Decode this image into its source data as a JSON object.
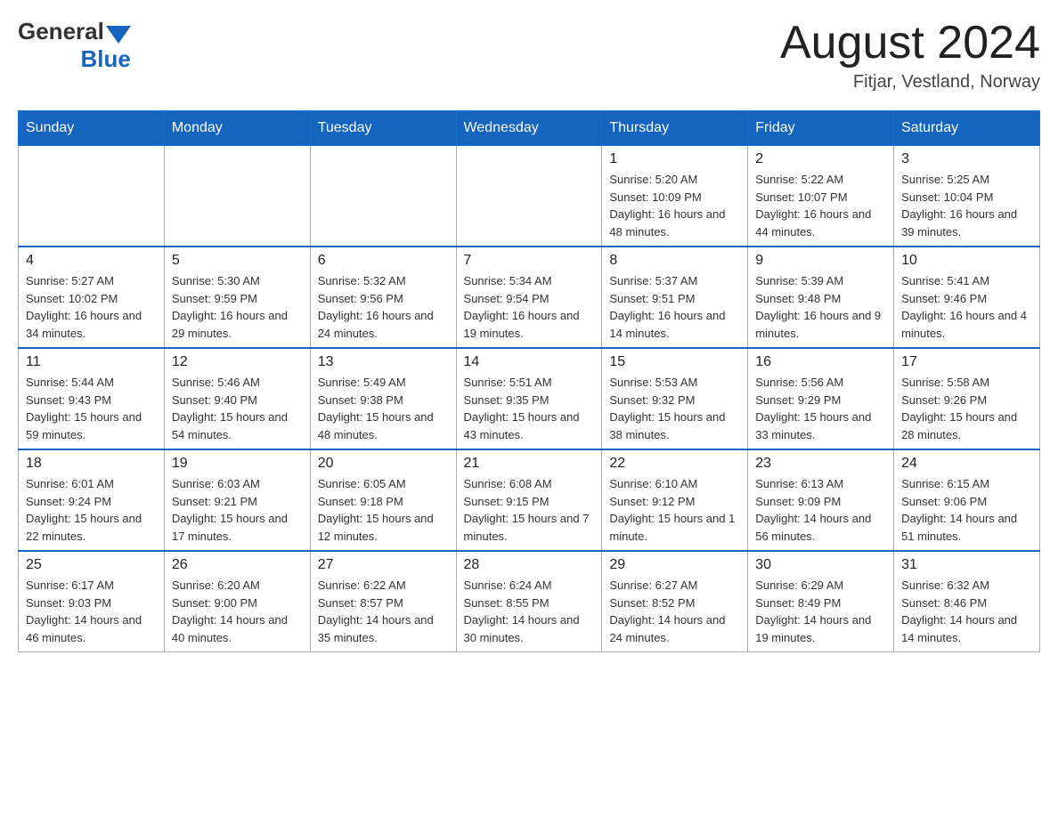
{
  "header": {
    "logo_general": "General",
    "logo_blue": "Blue",
    "title": "August 2024",
    "subtitle": "Fitjar, Vestland, Norway"
  },
  "days_of_week": [
    "Sunday",
    "Monday",
    "Tuesday",
    "Wednesday",
    "Thursday",
    "Friday",
    "Saturday"
  ],
  "weeks": [
    [
      {
        "day": "",
        "info": ""
      },
      {
        "day": "",
        "info": ""
      },
      {
        "day": "",
        "info": ""
      },
      {
        "day": "",
        "info": ""
      },
      {
        "day": "1",
        "info": "Sunrise: 5:20 AM\nSunset: 10:09 PM\nDaylight: 16 hours and 48 minutes."
      },
      {
        "day": "2",
        "info": "Sunrise: 5:22 AM\nSunset: 10:07 PM\nDaylight: 16 hours and 44 minutes."
      },
      {
        "day": "3",
        "info": "Sunrise: 5:25 AM\nSunset: 10:04 PM\nDaylight: 16 hours and 39 minutes."
      }
    ],
    [
      {
        "day": "4",
        "info": "Sunrise: 5:27 AM\nSunset: 10:02 PM\nDaylight: 16 hours and 34 minutes."
      },
      {
        "day": "5",
        "info": "Sunrise: 5:30 AM\nSunset: 9:59 PM\nDaylight: 16 hours and 29 minutes."
      },
      {
        "day": "6",
        "info": "Sunrise: 5:32 AM\nSunset: 9:56 PM\nDaylight: 16 hours and 24 minutes."
      },
      {
        "day": "7",
        "info": "Sunrise: 5:34 AM\nSunset: 9:54 PM\nDaylight: 16 hours and 19 minutes."
      },
      {
        "day": "8",
        "info": "Sunrise: 5:37 AM\nSunset: 9:51 PM\nDaylight: 16 hours and 14 minutes."
      },
      {
        "day": "9",
        "info": "Sunrise: 5:39 AM\nSunset: 9:48 PM\nDaylight: 16 hours and 9 minutes."
      },
      {
        "day": "10",
        "info": "Sunrise: 5:41 AM\nSunset: 9:46 PM\nDaylight: 16 hours and 4 minutes."
      }
    ],
    [
      {
        "day": "11",
        "info": "Sunrise: 5:44 AM\nSunset: 9:43 PM\nDaylight: 15 hours and 59 minutes."
      },
      {
        "day": "12",
        "info": "Sunrise: 5:46 AM\nSunset: 9:40 PM\nDaylight: 15 hours and 54 minutes."
      },
      {
        "day": "13",
        "info": "Sunrise: 5:49 AM\nSunset: 9:38 PM\nDaylight: 15 hours and 48 minutes."
      },
      {
        "day": "14",
        "info": "Sunrise: 5:51 AM\nSunset: 9:35 PM\nDaylight: 15 hours and 43 minutes."
      },
      {
        "day": "15",
        "info": "Sunrise: 5:53 AM\nSunset: 9:32 PM\nDaylight: 15 hours and 38 minutes."
      },
      {
        "day": "16",
        "info": "Sunrise: 5:56 AM\nSunset: 9:29 PM\nDaylight: 15 hours and 33 minutes."
      },
      {
        "day": "17",
        "info": "Sunrise: 5:58 AM\nSunset: 9:26 PM\nDaylight: 15 hours and 28 minutes."
      }
    ],
    [
      {
        "day": "18",
        "info": "Sunrise: 6:01 AM\nSunset: 9:24 PM\nDaylight: 15 hours and 22 minutes."
      },
      {
        "day": "19",
        "info": "Sunrise: 6:03 AM\nSunset: 9:21 PM\nDaylight: 15 hours and 17 minutes."
      },
      {
        "day": "20",
        "info": "Sunrise: 6:05 AM\nSunset: 9:18 PM\nDaylight: 15 hours and 12 minutes."
      },
      {
        "day": "21",
        "info": "Sunrise: 6:08 AM\nSunset: 9:15 PM\nDaylight: 15 hours and 7 minutes."
      },
      {
        "day": "22",
        "info": "Sunrise: 6:10 AM\nSunset: 9:12 PM\nDaylight: 15 hours and 1 minute."
      },
      {
        "day": "23",
        "info": "Sunrise: 6:13 AM\nSunset: 9:09 PM\nDaylight: 14 hours and 56 minutes."
      },
      {
        "day": "24",
        "info": "Sunrise: 6:15 AM\nSunset: 9:06 PM\nDaylight: 14 hours and 51 minutes."
      }
    ],
    [
      {
        "day": "25",
        "info": "Sunrise: 6:17 AM\nSunset: 9:03 PM\nDaylight: 14 hours and 46 minutes."
      },
      {
        "day": "26",
        "info": "Sunrise: 6:20 AM\nSunset: 9:00 PM\nDaylight: 14 hours and 40 minutes."
      },
      {
        "day": "27",
        "info": "Sunrise: 6:22 AM\nSunset: 8:57 PM\nDaylight: 14 hours and 35 minutes."
      },
      {
        "day": "28",
        "info": "Sunrise: 6:24 AM\nSunset: 8:55 PM\nDaylight: 14 hours and 30 minutes."
      },
      {
        "day": "29",
        "info": "Sunrise: 6:27 AM\nSunset: 8:52 PM\nDaylight: 14 hours and 24 minutes."
      },
      {
        "day": "30",
        "info": "Sunrise: 6:29 AM\nSunset: 8:49 PM\nDaylight: 14 hours and 19 minutes."
      },
      {
        "day": "31",
        "info": "Sunrise: 6:32 AM\nSunset: 8:46 PM\nDaylight: 14 hours and 14 minutes."
      }
    ]
  ]
}
